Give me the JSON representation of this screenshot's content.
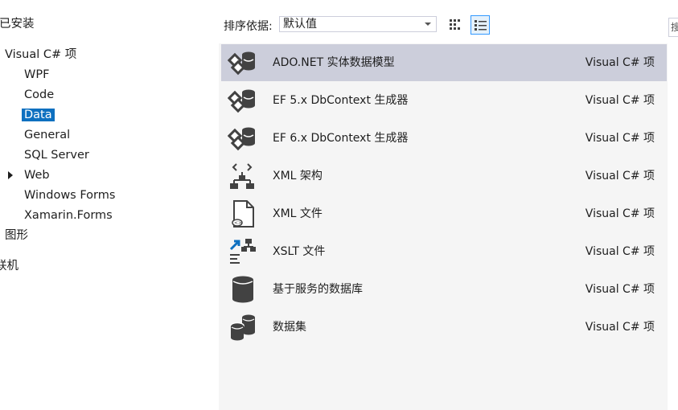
{
  "tree": {
    "installed": "已安装",
    "visual_csharp": "Visual C# 项",
    "items": [
      "WPF",
      "Code",
      "Data",
      "General",
      "SQL Server",
      "Web",
      "Windows Forms",
      "Xamarin.Forms"
    ],
    "graphics": "图形",
    "online": "联机"
  },
  "toolbar": {
    "sort_label": "排序依据:",
    "sort_value": "默认值",
    "search_stub": "搜"
  },
  "templates": [
    {
      "name": "ADO.NET 实体数据模型",
      "type": "Visual C# 项",
      "icon": "entity-model-icon"
    },
    {
      "name": "EF 5.x DbContext 生成器",
      "type": "Visual C# 项",
      "icon": "dbcontext-generator-icon"
    },
    {
      "name": "EF 6.x DbContext 生成器",
      "type": "Visual C# 项",
      "icon": "dbcontext-generator-icon"
    },
    {
      "name": "XML 架构",
      "type": "Visual C# 项",
      "icon": "xml-schema-icon"
    },
    {
      "name": "XML 文件",
      "type": "Visual C# 项",
      "icon": "xml-file-icon"
    },
    {
      "name": "XSLT 文件",
      "type": "Visual C# 项",
      "icon": "xslt-file-icon"
    },
    {
      "name": "基于服务的数据库",
      "type": "Visual C# 项",
      "icon": "database-icon"
    },
    {
      "name": "数据集",
      "type": "Visual C# 项",
      "icon": "dataset-icon"
    }
  ],
  "colors": {
    "selection": "#0e70c0",
    "row_selected": "#cccedb",
    "list_bg": "#f5f5f5",
    "icon": "#424242"
  }
}
